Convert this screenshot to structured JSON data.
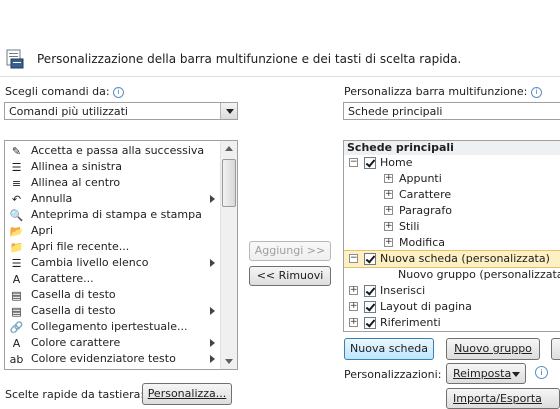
{
  "header": {
    "description": "Personalizzazione della barra multifunzione e dei tasti di scelta rapida."
  },
  "left": {
    "choose_label": "Scegli comandi da:",
    "choose_value": "Comandi più utilizzati",
    "commands": [
      {
        "label": "Accetta e passa alla successiva",
        "icon": "accept-next-icon",
        "glyph": "✎",
        "submenu": false
      },
      {
        "label": "Allinea a sinistra",
        "icon": "align-left-icon",
        "glyph": "☰",
        "submenu": false
      },
      {
        "label": "Allinea al centro",
        "icon": "align-center-icon",
        "glyph": "≡",
        "submenu": false
      },
      {
        "label": "Annulla",
        "icon": "undo-icon",
        "glyph": "↶",
        "submenu": true
      },
      {
        "label": "Anteprima di stampa e stampa",
        "icon": "print-preview-icon",
        "glyph": "🔍",
        "submenu": false
      },
      {
        "label": "Apri",
        "icon": "open-folder-icon",
        "glyph": "📂",
        "submenu": false
      },
      {
        "label": "Apri file recente...",
        "icon": "recent-file-icon",
        "glyph": "📁",
        "submenu": false
      },
      {
        "label": "Cambia livello elenco",
        "icon": "list-level-icon",
        "glyph": "☰",
        "submenu": true
      },
      {
        "label": "Carattere...",
        "icon": "font-icon",
        "glyph": "A",
        "submenu": false
      },
      {
        "label": "Casella di testo",
        "icon": "text-box-icon",
        "glyph": "▤",
        "submenu": false
      },
      {
        "label": "Casella di testo",
        "icon": "text-box-icon",
        "glyph": "▤",
        "submenu": true
      },
      {
        "label": "Collegamento ipertestuale...",
        "icon": "hyperlink-icon",
        "glyph": "🔗",
        "submenu": false
      },
      {
        "label": "Colore carattere",
        "icon": "font-color-icon",
        "glyph": "A",
        "submenu": true
      },
      {
        "label": "Colore evidenziatore testo",
        "icon": "highlight-icon",
        "glyph": "ab",
        "submenu": true
      }
    ],
    "shortcuts_label": "Scelte rapide da tastiera:",
    "customize_button": "Personalizza..."
  },
  "middle": {
    "add_button": "Aggiungi >>",
    "remove_button": "<< Rimuovi"
  },
  "right": {
    "ribbon_label": "Personalizza barra multifunzione:",
    "ribbon_value": "Schede principali",
    "tree_header": "Schede principali",
    "tree": [
      {
        "label": "Home",
        "level": 0,
        "expander": "−",
        "checkbox": true
      },
      {
        "label": "Appunti",
        "level": 1,
        "expander": "+",
        "checkbox": false
      },
      {
        "label": "Carattere",
        "level": 1,
        "expander": "+",
        "checkbox": false
      },
      {
        "label": "Paragrafo",
        "level": 1,
        "expander": "+",
        "checkbox": false
      },
      {
        "label": "Stili",
        "level": 1,
        "expander": "+",
        "checkbox": false
      },
      {
        "label": "Modifica",
        "level": 1,
        "expander": "+",
        "checkbox": false
      },
      {
        "label": "Nuova scheda (personalizzata)",
        "level": 0,
        "expander": "−",
        "checkbox": true,
        "selected": true
      },
      {
        "label": "Nuovo gruppo (personalizzata)",
        "level": 2,
        "expander": "",
        "checkbox": false
      },
      {
        "label": "Inserisci",
        "level": 0,
        "expander": "+",
        "checkbox": true
      },
      {
        "label": "Layout di pagina",
        "level": 0,
        "expander": "+",
        "checkbox": true
      },
      {
        "label": "Riferimenti",
        "level": 0,
        "expander": "+",
        "checkbox": true
      }
    ],
    "new_tab_button": "Nuova scheda",
    "new_group_button": "Nuovo gruppo",
    "customizations_label": "Personalizzazioni:",
    "reset_button": "Reimposta",
    "import_export_button": "Importa/Esporta"
  }
}
